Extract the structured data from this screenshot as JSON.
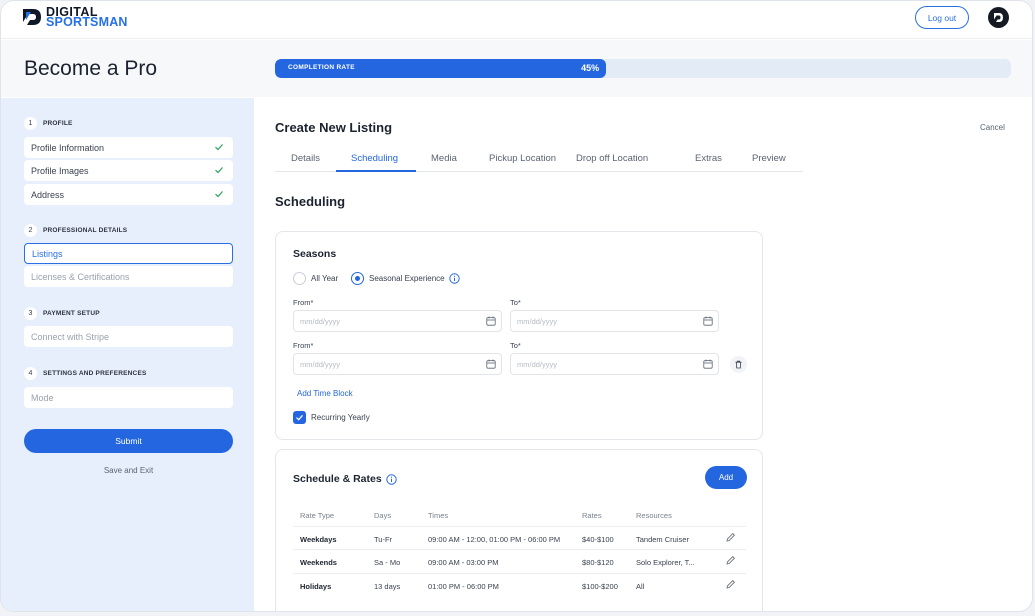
{
  "app": {
    "logo_line1": "DIGITAL",
    "logo_line2": "SPORTSMAN",
    "logout_label": "Log out"
  },
  "header": {
    "page_title": "Become a Pro",
    "progress_label": "COMPLETION RATE",
    "progress_value": "45%",
    "progress_fraction": 0.45
  },
  "sidebar": {
    "sections": [
      {
        "num": "1",
        "title": "PROFILE"
      },
      {
        "num": "2",
        "title": "PROFESSIONAL DETAILS"
      },
      {
        "num": "3",
        "title": "PAYMENT SETUP"
      },
      {
        "num": "4",
        "title": "SETTINGS AND PREFERENCES"
      }
    ],
    "items": [
      {
        "label": "Profile Information",
        "complete": true
      },
      {
        "label": "Profile Images",
        "complete": true
      },
      {
        "label": "Address",
        "complete": true
      },
      {
        "label": "Listings",
        "active": true
      },
      {
        "label": "Licenses & Certifications"
      },
      {
        "label": "Connect with Stripe"
      },
      {
        "label": "Mode"
      }
    ],
    "submit_label": "Submit",
    "save_exit_label": "Save and Exit"
  },
  "main": {
    "title": "Create New Listing",
    "cancel_label": "Cancel",
    "tabs": [
      "Details",
      "Scheduling",
      "Media",
      "Pickup Location",
      "Drop off Location",
      "Extras",
      "Preview"
    ],
    "active_tab": "Scheduling",
    "section_title": "Scheduling"
  },
  "seasons": {
    "title": "Seasons",
    "option_all_year": "All Year",
    "option_seasonal": "Seasonal Experience",
    "selected": "Seasonal Experience",
    "from_label": "From*",
    "to_label": "To*",
    "date_placeholder": "mm/dd/yyyy",
    "add_time_block": "Add Time Block",
    "recurring_label": "Recurring Yearly",
    "recurring_checked": true
  },
  "schedule": {
    "title": "Schedule & Rates",
    "add_label": "Add",
    "columns": [
      "Rate Type",
      "Days",
      "Times",
      "Rates",
      "Resources"
    ],
    "rows": [
      {
        "rate_type": "Weekdays",
        "days": "Tu-Fr",
        "times": "09:00 AM - 12:00, 01:00 PM - 06:00 PM",
        "rates": "$40-$100",
        "resources": "Tandem Cruiser"
      },
      {
        "rate_type": "Weekends",
        "days": "Sa - Mo",
        "times": "09:00 AM - 03:00 PM",
        "rates": "$80-$120",
        "resources": "Solo Explorer, T..."
      },
      {
        "rate_type": "Holidays",
        "days": "13 days",
        "times": "01:00 PM - 06:00 PM",
        "rates": "$100-$200",
        "resources": "All"
      }
    ]
  },
  "colors": {
    "accent": "#2466e0",
    "sidebar_bg": "#e8effc",
    "check_green": "#2fa35a"
  }
}
